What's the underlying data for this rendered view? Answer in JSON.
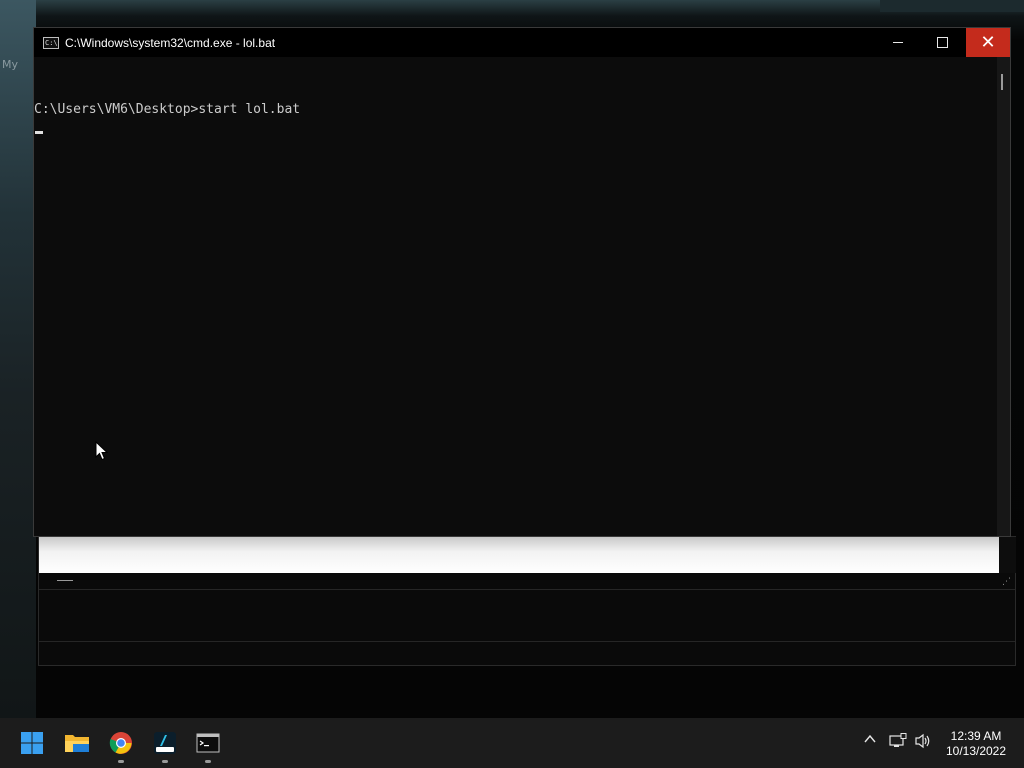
{
  "desktop": {
    "icon_label": "My"
  },
  "cmd_window": {
    "title": "C:\\Windows\\system32\\cmd.exe - lol.bat",
    "icon_text": "C:\\",
    "console_lines": [
      "C:\\Users\\VM6\\Desktop>start lol.bat"
    ],
    "close_symbol": "✕"
  },
  "taskbar": {
    "apps": [
      {
        "name": "Start",
        "icon": "windows-logo-icon"
      },
      {
        "name": "File Explorer",
        "icon": "folder-icon"
      },
      {
        "name": "Google Chrome",
        "icon": "chrome-icon"
      },
      {
        "name": "App",
        "icon": "app-icon"
      },
      {
        "name": "Command Prompt",
        "icon": "terminal-icon"
      }
    ],
    "tray": {
      "chevron": "^",
      "clock_time": "12:39 AM",
      "clock_date": "10/13/2022"
    }
  },
  "colors": {
    "close_button": "#c42b1c",
    "console_bg": "#0c0c0c",
    "console_text": "#cccccc",
    "taskbar_bg": "#1c1c1c"
  }
}
